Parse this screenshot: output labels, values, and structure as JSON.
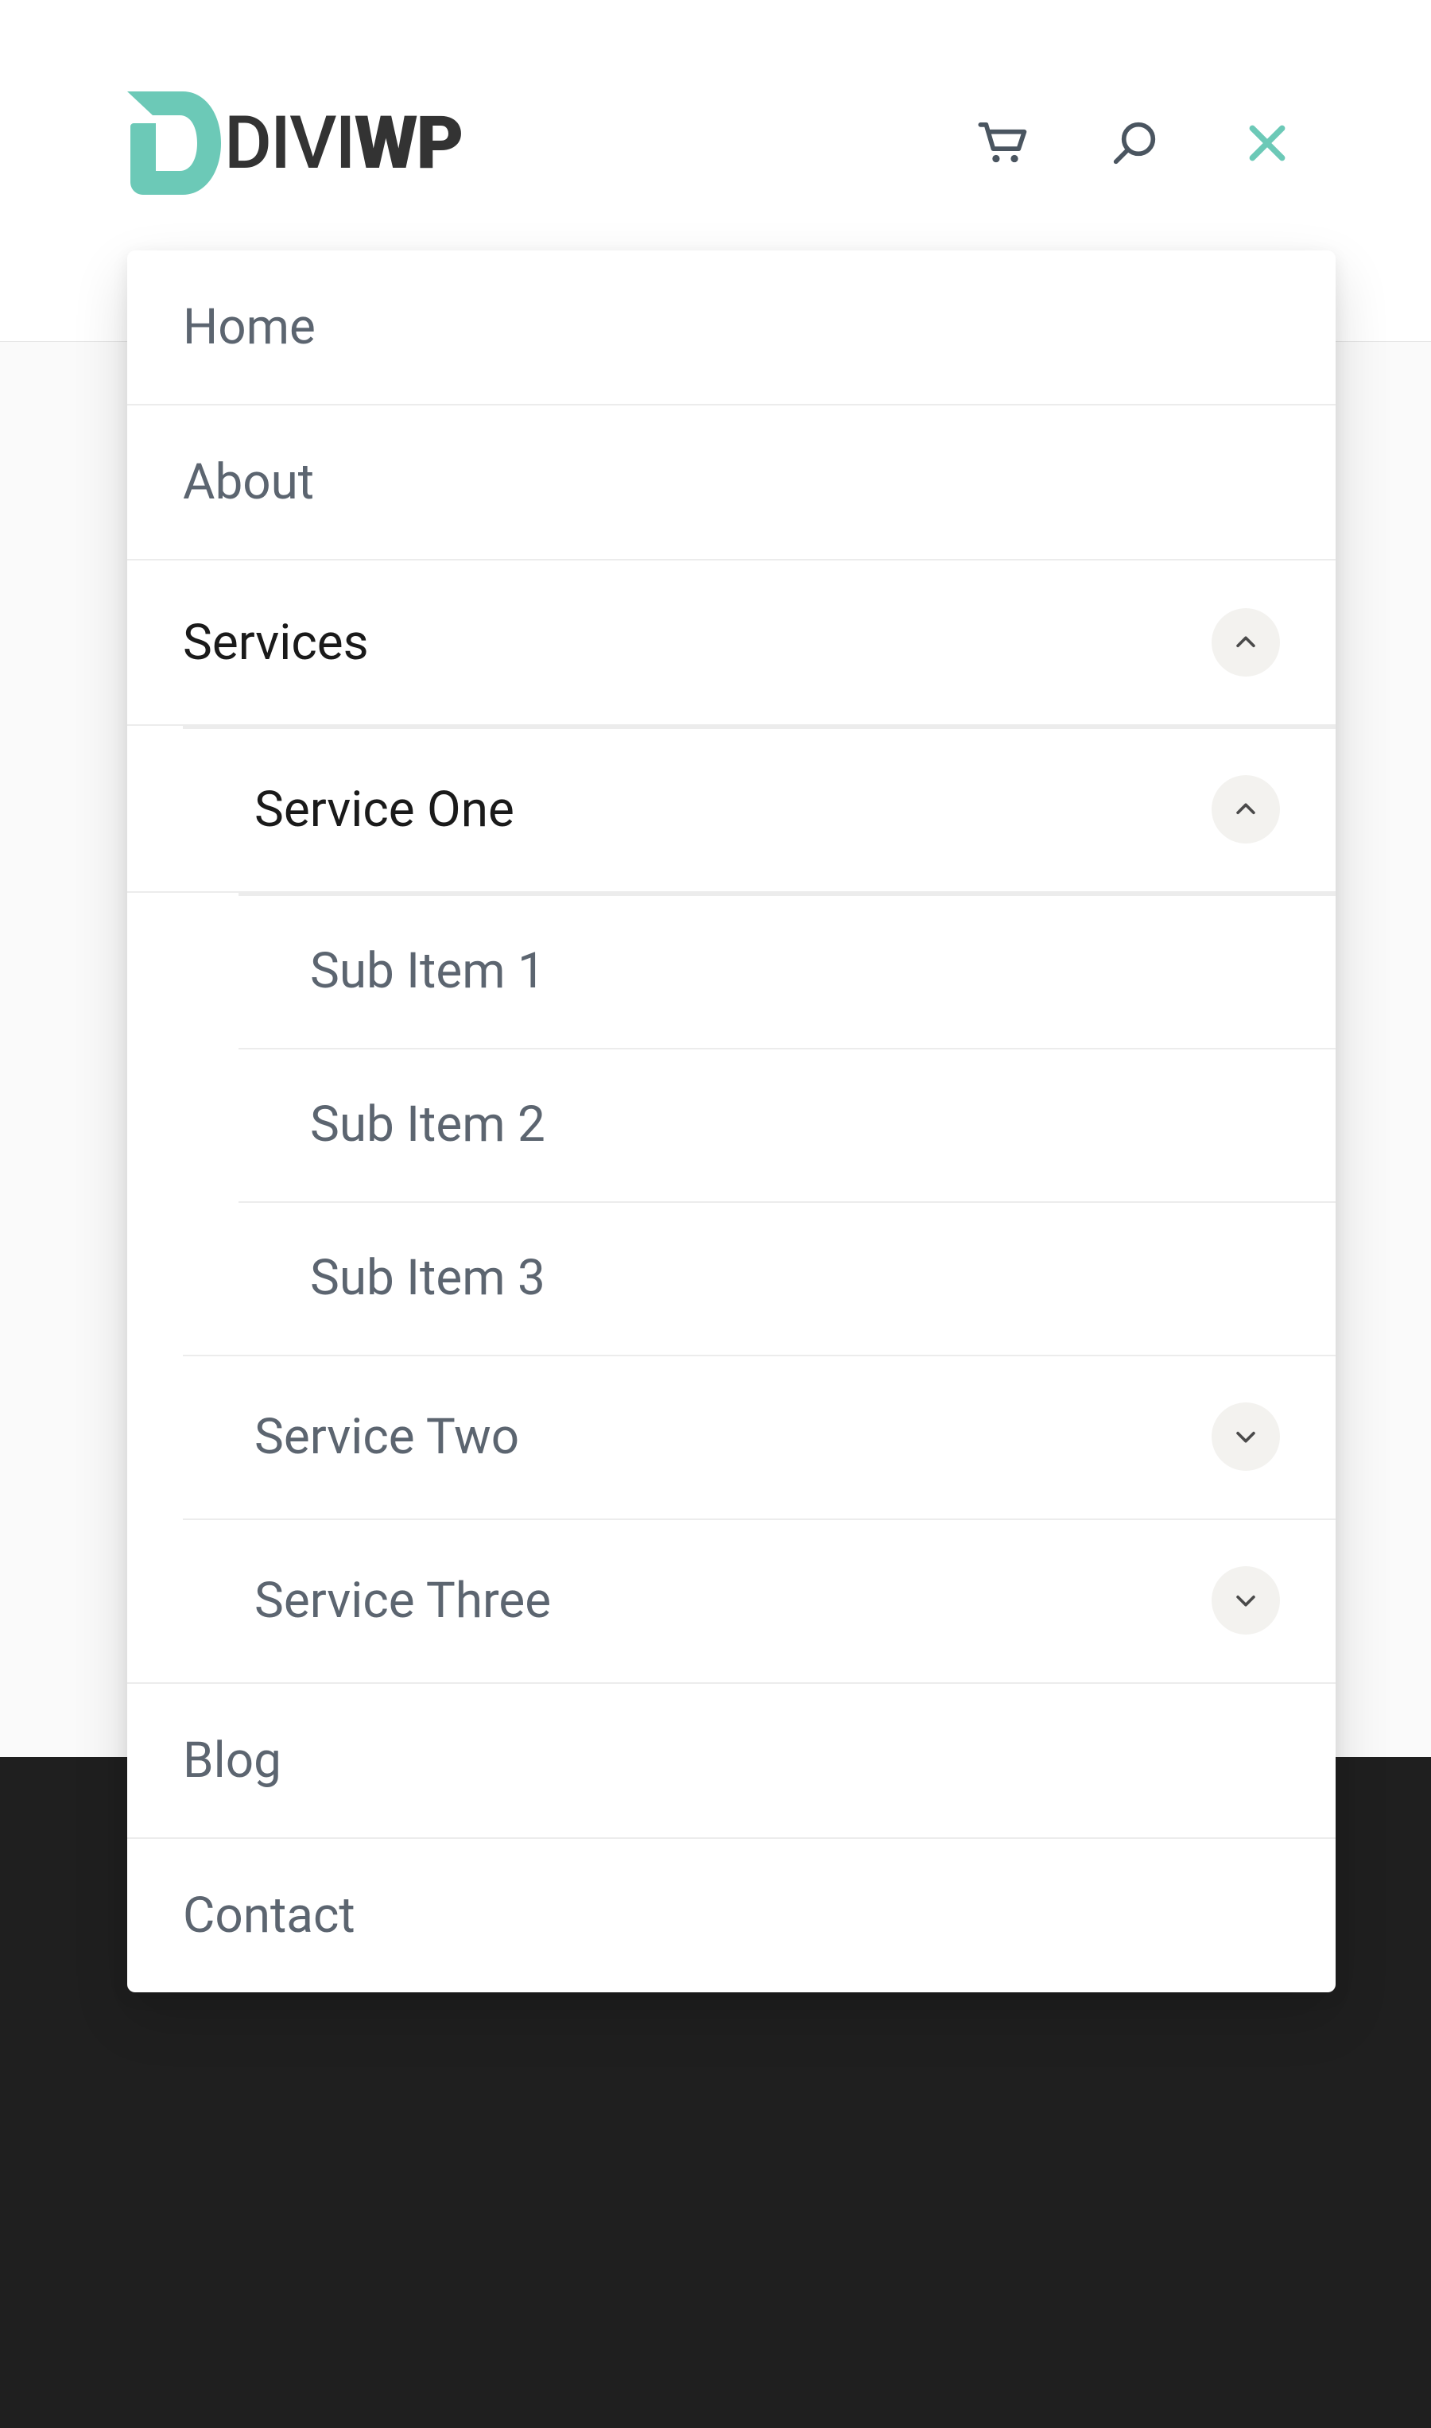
{
  "logo": {
    "text_left": "DIVI",
    "text_right": "WP"
  },
  "header_icons": {
    "cart": "cart-icon",
    "search": "search-icon",
    "close": "close-icon"
  },
  "menu": {
    "home": "Home",
    "about": "About",
    "services": {
      "label": "Services",
      "expanded": true,
      "items": {
        "service_one": {
          "label": "Service One",
          "expanded": true,
          "sub": [
            "Sub Item 1",
            "Sub Item 2",
            "Sub Item 3"
          ]
        },
        "service_two": {
          "label": "Service Two",
          "expanded": false
        },
        "service_three": {
          "label": "Service Three",
          "expanded": false
        }
      }
    },
    "blog": "Blog",
    "contact": "Contact"
  },
  "colors": {
    "accent": "#6cc9b7",
    "icon_gray": "#4a5560",
    "icon_active": "#6cc9b7",
    "text_muted": "#5c6570",
    "text_active": "#1a1a1a"
  }
}
